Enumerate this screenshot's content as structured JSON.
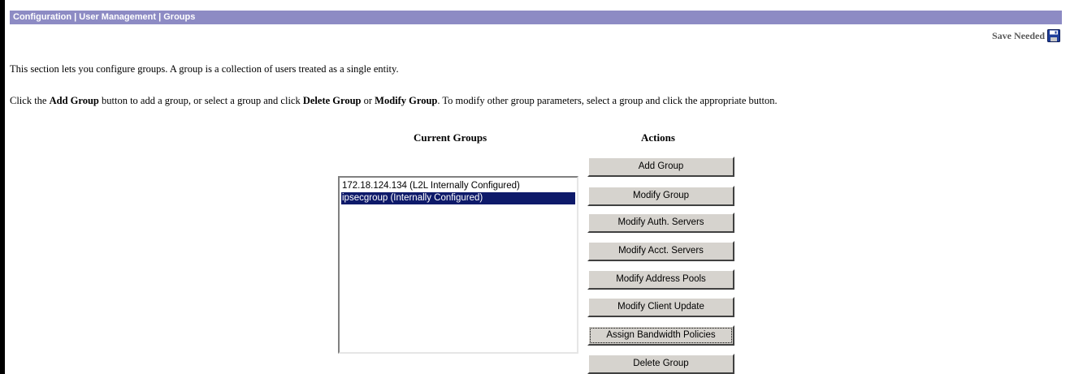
{
  "header": {
    "breadcrumb": "Configuration | User Management | Groups"
  },
  "save_status": {
    "label": "Save Needed",
    "icon": "disk-icon"
  },
  "intro_text": "This section lets you configure groups. A group is a collection of users treated as a single entity.",
  "instructions": {
    "part1": "Click the ",
    "add_group": "Add Group",
    "part2": " button to add a group, or select a group and click ",
    "delete_group": "Delete Group",
    "part3": " or ",
    "modify_group": "Modify Group",
    "part4": ". To modify other group parameters, select a group and click the appropriate button."
  },
  "current_groups": {
    "heading": "Current Groups",
    "items": [
      {
        "label": "172.18.124.134 (L2L Internally Configured)",
        "selected": false
      },
      {
        "label": "ipsecgroup (Internally Configured)",
        "selected": true
      }
    ]
  },
  "actions": {
    "heading": "Actions",
    "buttons": [
      "Add Group",
      "Modify Group",
      "Modify Auth. Servers",
      "Modify Acct. Servers",
      "Modify Address Pools",
      "Modify Client Update",
      "Assign Bandwidth Policies",
      "Delete Group"
    ]
  },
  "colors": {
    "header_bar": "#8d8bc4",
    "selection": "#0e1a6a",
    "button_face": "#d6d3ce"
  }
}
